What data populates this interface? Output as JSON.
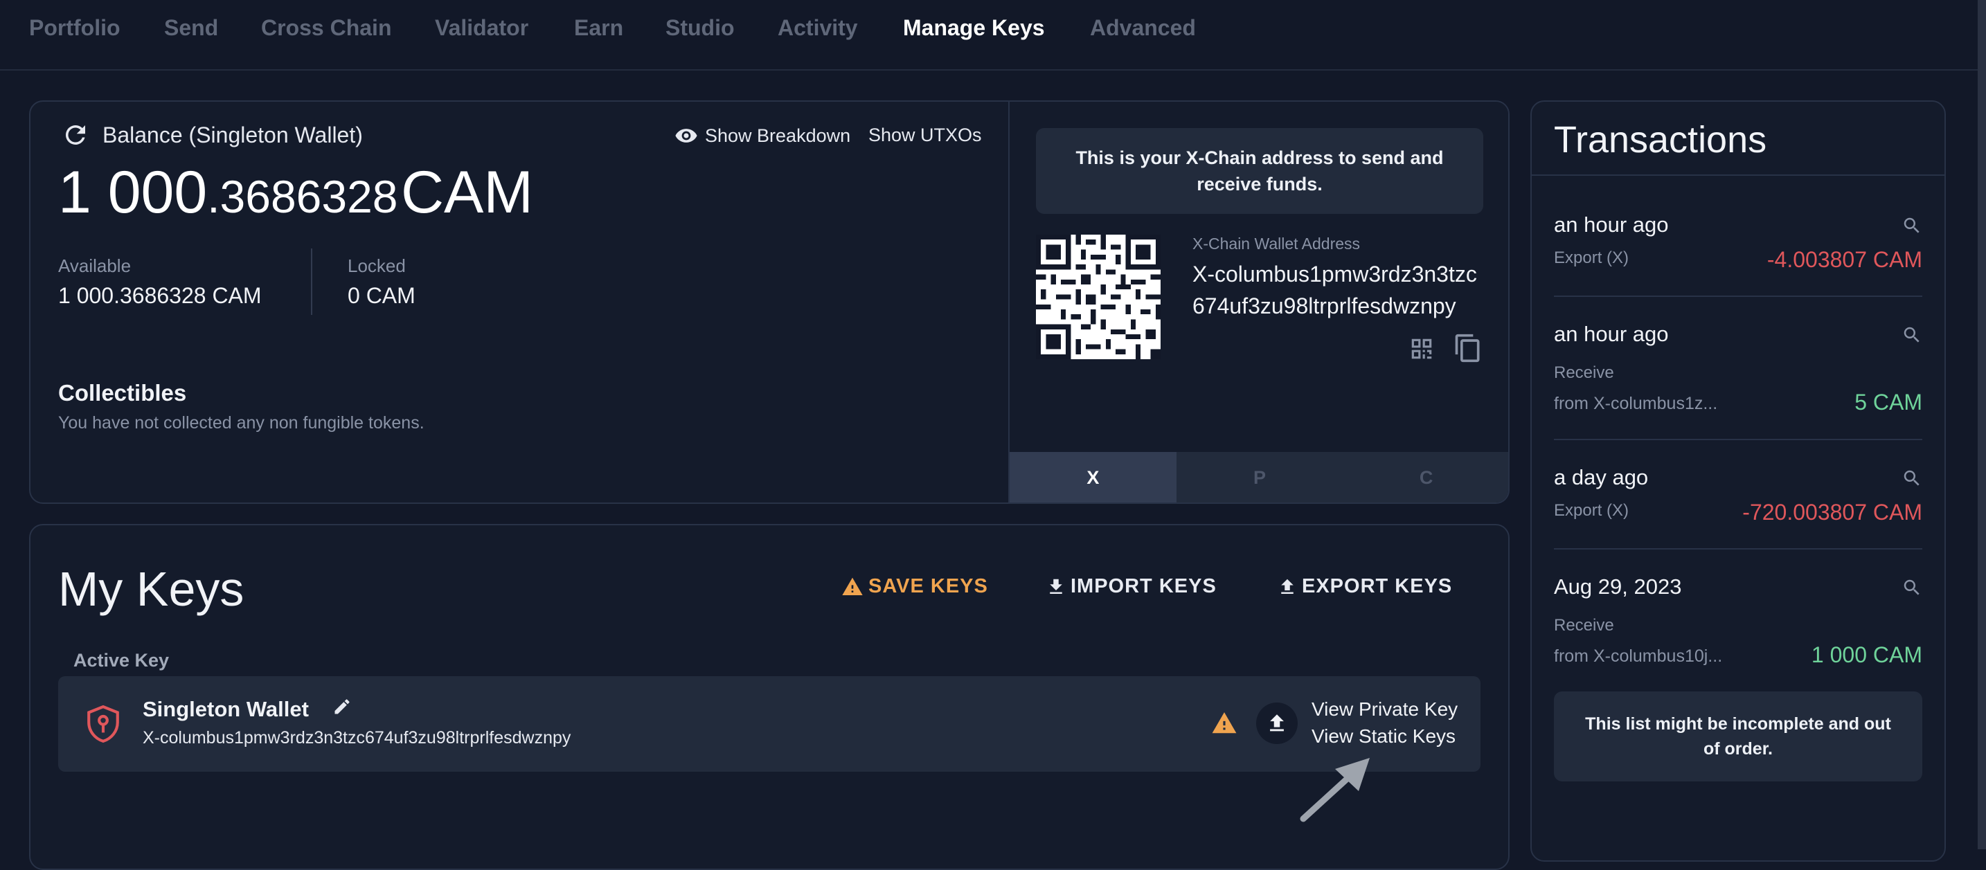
{
  "nav": {
    "items": [
      {
        "label": "Portfolio",
        "active": false
      },
      {
        "label": "Send",
        "active": false
      },
      {
        "label": "Cross Chain",
        "active": false
      },
      {
        "label": "Validator",
        "active": false
      },
      {
        "label": "Earn",
        "active": false
      },
      {
        "label": "Studio",
        "active": false
      },
      {
        "label": "Activity",
        "active": false
      },
      {
        "label": "Manage Keys",
        "active": true
      },
      {
        "label": "Advanced",
        "active": false
      }
    ]
  },
  "balance": {
    "title": "Balance (Singleton Wallet)",
    "show_breakdown": "Show Breakdown",
    "show_utxos": "Show UTXOs",
    "amount_whole": "1 000",
    "amount_decimals": ".3686328",
    "currency": "CAM",
    "available_label": "Available",
    "available_value": "1 000.3686328 CAM",
    "locked_label": "Locked",
    "locked_value": "0 CAM",
    "collectibles_title": "Collectibles",
    "collectibles_text": "You have not collected any non fungible tokens."
  },
  "address": {
    "note": "This is your X-Chain address to send and receive funds.",
    "label": "X-Chain Wallet Address",
    "value": "X-columbus1pmw3rdz3n3tzc674uf3zu98ltrprlfesdwznpy",
    "chains": [
      {
        "label": "X",
        "active": true
      },
      {
        "label": "P",
        "active": false
      },
      {
        "label": "C",
        "active": false
      }
    ]
  },
  "keys": {
    "title": "My Keys",
    "save_keys": "SAVE KEYS",
    "import_keys": "IMPORT KEYS",
    "export_keys": "EXPORT KEYS",
    "active_key_label": "Active Key",
    "wallet_name": "Singleton Wallet",
    "wallet_address": "X-columbus1pmw3rdz3n3tzc674uf3zu98ltrprlfesdwznpy",
    "view_private_key": "View Private Key",
    "view_static_keys": "View Static Keys"
  },
  "transactions": {
    "title": "Transactions",
    "items": [
      {
        "time": "an hour ago",
        "type": "Export (X)",
        "from": "",
        "amount": "-4.003807 CAM",
        "direction": "out"
      },
      {
        "time": "an hour ago",
        "type": "Receive",
        "from": "from X-columbus1z...",
        "amount": "5 CAM",
        "direction": "in"
      },
      {
        "time": "a day ago",
        "type": "Export (X)",
        "from": "",
        "amount": "-720.003807 CAM",
        "direction": "out"
      },
      {
        "time": "Aug 29, 2023",
        "type": "Receive",
        "from": "from X-columbus10j...",
        "amount": "1 000 CAM",
        "direction": "in"
      }
    ],
    "note": "This list might be incomplete and out of order."
  },
  "colors": {
    "background": "#121828",
    "card": "#141b2b",
    "warning": "#f0a44f",
    "negative": "#e0575b",
    "positive": "#6fd39a"
  }
}
